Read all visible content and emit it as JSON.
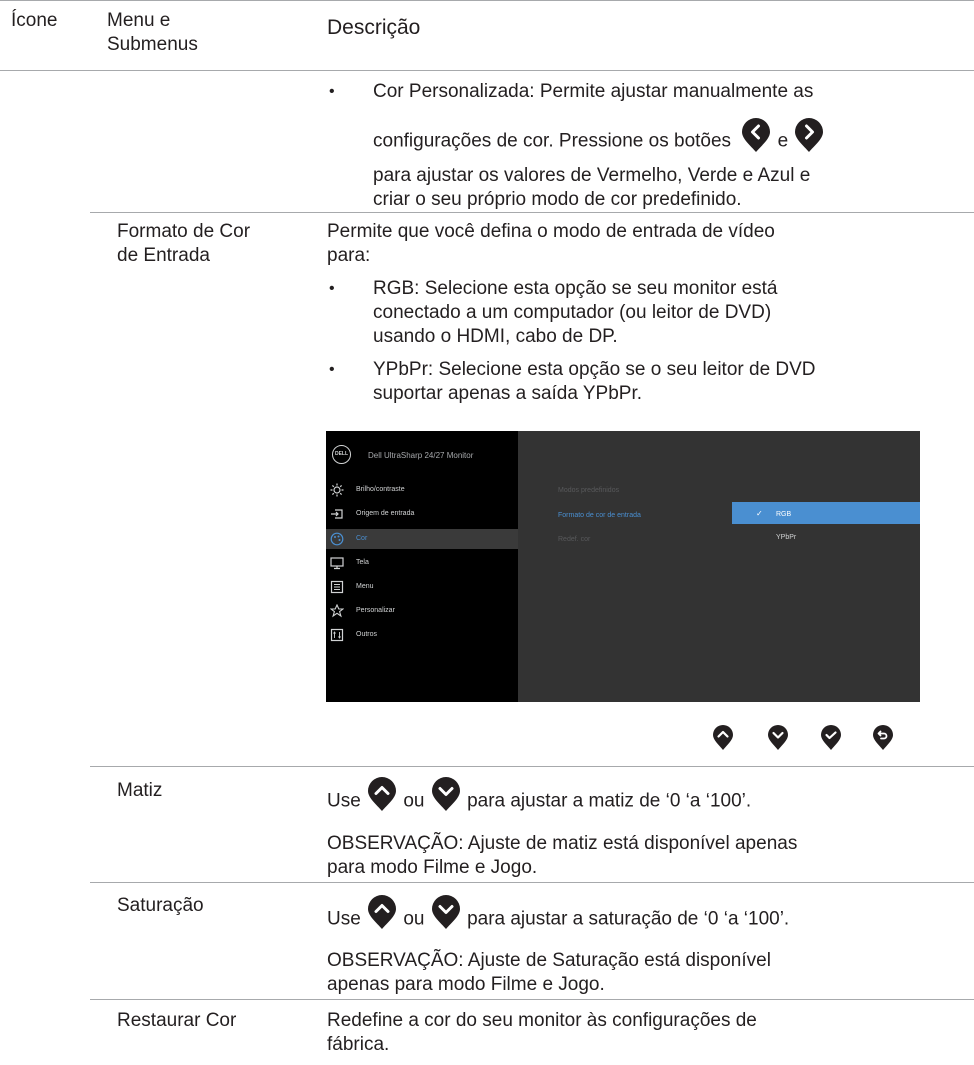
{
  "header": {
    "icon_col": "Ícone",
    "menu_col_line1": "Menu e",
    "menu_col_line2": "Submenus",
    "desc_col": "Descrição"
  },
  "rows": {
    "custom_color": {
      "line1": "Cor Personalizada: Permite ajustar manualmente as",
      "line2_prefix": "configurações de cor. Pressione os botões",
      "line2_and": "e",
      "line3": "para ajustar os valores de Vermelho, Verde e Azul e",
      "line4": "criar o seu próprio modo de cor predefinido."
    },
    "input_color_format": {
      "menu_line1": "Formato de Cor",
      "menu_line2": "de Entrada",
      "desc_line1": "Permite que você defina o modo de entrada de vídeo",
      "desc_line2": "para:",
      "rgb_line1": "RGB: Selecione esta opção se seu monitor está",
      "rgb_line2": "conectado a um computador (ou leitor de DVD)",
      "rgb_line3": "usando o HDMI, cabo de DP.",
      "ypbpr_line1": "YPbPr: Selecione esta opção se o seu leitor de DVD",
      "ypbpr_line2": "suportar apenas a saída YPbPr."
    },
    "hue": {
      "menu": "Matiz",
      "use": "Use",
      "or": "ou",
      "desc_rest": "para ajustar a matiz de ‘0 ‘a ‘100’.",
      "note_line1": "OBSERVAÇÃO: Ajuste de matiz está disponível apenas",
      "note_line2": "para modo Filme e Jogo."
    },
    "saturation": {
      "menu": "Saturação",
      "use": "Use",
      "or": "ou",
      "desc_rest": "para ajustar a saturação de ‘0 ‘a ‘100’.",
      "note_line1": "OBSERVAÇÃO: Ajuste de Saturação está disponível",
      "note_line2": "apenas para modo Filme e Jogo."
    },
    "reset_color": {
      "menu": "Restaurar Cor",
      "desc_line1": "Redefine a cor do seu monitor às configurações de",
      "desc_line2": "fábrica."
    }
  },
  "osd": {
    "logo": "DELL",
    "title": "Dell UltraSharp 24/27 Monitor",
    "menu_items": [
      {
        "label": "Brilho/contraste",
        "icon": "sun-icon"
      },
      {
        "label": "Origem de entrada",
        "icon": "input-source-icon"
      },
      {
        "label": "Cor",
        "icon": "palette-icon"
      },
      {
        "label": "Tela",
        "icon": "display-icon"
      },
      {
        "label": "Menu",
        "icon": "menu-list-icon"
      },
      {
        "label": "Personalizar",
        "icon": "star-icon"
      },
      {
        "label": "Outros",
        "icon": "others-icon"
      }
    ],
    "submenu": [
      "Modos predefinidos",
      "Formato de cor de entrada",
      "Redef. cor"
    ],
    "options": [
      "RGB",
      "YPbPr"
    ],
    "selected_option": "RGB",
    "selected_check": "✓",
    "highlight_color": "#4a8fd1",
    "active_label_color": "#4a8fd1"
  },
  "nav_buttons": [
    "up-icon",
    "down-icon",
    "check-icon",
    "back-icon"
  ]
}
